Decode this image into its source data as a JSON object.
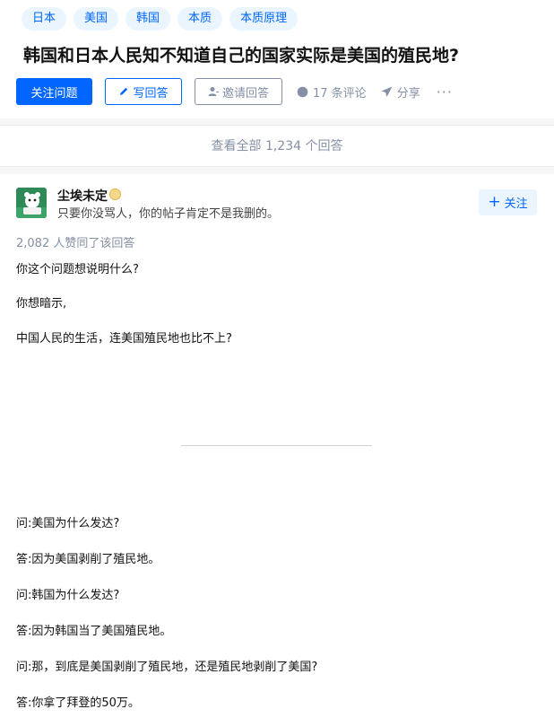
{
  "topics": [
    "日本",
    "美国",
    "韩国",
    "本质",
    "本质原理"
  ],
  "question": {
    "title": "韩国和日本人民知不知道自己的国家实际是美国的殖民地?"
  },
  "actions": {
    "follow_question": "关注问题",
    "write_answer": "写回答",
    "invite_answer": "邀请回答",
    "comments": "17 条评论",
    "share": "分享",
    "more": "···"
  },
  "view_all": "查看全部 1,234 个回答",
  "answer": {
    "author_name": "尘埃未定",
    "author_bio": "只要你没骂人，你的帖子肯定不是我删的。",
    "follow_label": "关注",
    "votes": "2,082 人赞同了该回答",
    "paragraphs": [
      "你这个问题想说明什么?",
      "你想暗示,",
      "中国人民的生活，连美国殖民地也比不上?",
      "问:美国为什么发达?",
      "答:因为美国剥削了殖民地。",
      "问:韩国为什么发达?",
      "答:因为韩国当了美国殖民地。",
      "问:那，到底是美国剥削了殖民地，还是殖民地剥削了美国?",
      "答:你拿了拜登的50万。"
    ]
  },
  "colors": {
    "brand_blue": "#0066ff",
    "meta_gray": "#8590a6",
    "topic_bg": "#ebf5ff",
    "avatar_green": "#2e8b57"
  },
  "icons": [
    "pen-icon",
    "invite-user-icon",
    "comment-icon",
    "share-plane-icon",
    "plus-icon",
    "author-badge-icon"
  ]
}
